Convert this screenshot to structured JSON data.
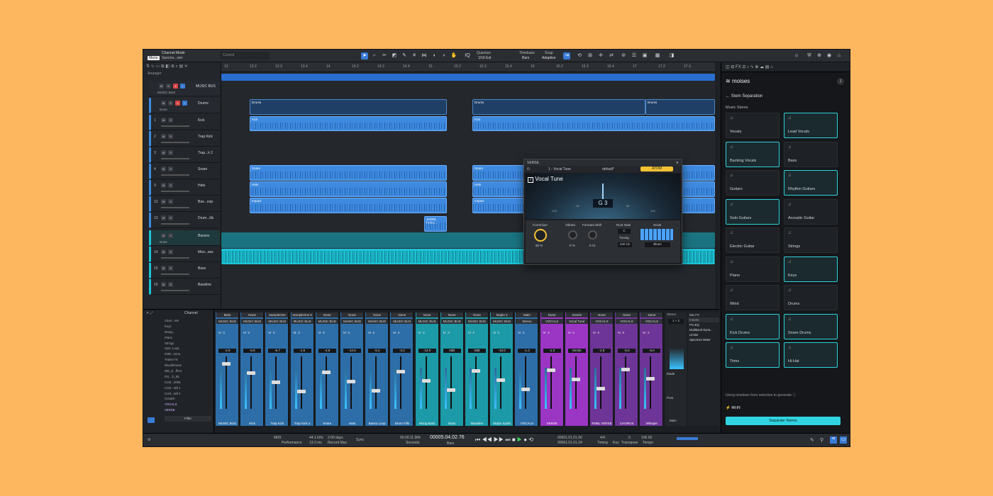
{
  "topbar": {
    "mode_label": "Channel Mode",
    "mode_value": "Spectra...ster",
    "control_label": "Control",
    "quantize_label": "Quantize",
    "quantize_value": "1/16 Ext",
    "timebase_label": "Timebase",
    "timebase_value": "Bars",
    "snap_label": "Snap",
    "snap_value": "Adaptive",
    "badge": "Mono"
  },
  "ruler": [
    "13",
    "13.2",
    "13.3",
    "13.4",
    "14",
    "14.2",
    "14.3",
    "14.4",
    "15",
    "15.2",
    "15.3",
    "15.4",
    "16",
    "16.2",
    "16.3",
    "16.4",
    "17",
    "17.2",
    "17.3"
  ],
  "tracks": {
    "arranger_label": "Arranger",
    "folders": [
      {
        "label": "MUSIC BUS",
        "sub": "MUSIC BUS"
      },
      {
        "label": "Drums",
        "sub": "None"
      },
      {
        "label": "Basses",
        "sub": "None"
      }
    ],
    "rows": [
      {
        "num": "1",
        "name": "Kick"
      },
      {
        "num": "2",
        "name": "Trap Kick"
      },
      {
        "num": "3",
        "name": "Trap...k 2"
      },
      {
        "num": "4",
        "name": "Snare"
      },
      {
        "num": "9",
        "name": "Hats"
      },
      {
        "num": "12",
        "name": "Bas...oop"
      },
      {
        "num": "13",
        "name": "Drum...ills"
      },
      {
        "num": "14",
        "name": "Moo...ass"
      },
      {
        "num": "15",
        "name": "Bass"
      },
      {
        "num": "16",
        "name": "Bassline"
      }
    ],
    "clips": {
      "drums": "Drums",
      "kick": "Kick",
      "snare": "Snare",
      "hats": "Hats",
      "impact": "Impact",
      "fill": "JHDRL FHDJ..."
    }
  },
  "plugin": {
    "window_title": "VERSE",
    "preset_slot": "1 - Vocal Tune",
    "preset_name": "default*",
    "mode_badge": "ATOM",
    "name": "Vocal Tune",
    "note": "G 3",
    "scale_marks": [
      "-100",
      "-50",
      "0",
      "50",
      "100"
    ],
    "correction_label": "Correction",
    "correction_value": "80 %",
    "vibrato_label": "Vibrato",
    "vibrato_value": "0 %",
    "formant_label": "Formant Shift",
    "formant_value": "0 Ct",
    "rootnote_label": "Root Note",
    "rootnote_value": "C",
    "tuning_label": "Tuning",
    "tuning_value": "440 Hz",
    "scale_label": "Scale",
    "scale_value": "Blues"
  },
  "moises": {
    "brand": "moises",
    "section": "Stem Separation",
    "group": "Music Stems",
    "stems": [
      {
        "label": "Vocals",
        "sel": false
      },
      {
        "label": "Lead Vocals",
        "sel": true
      },
      {
        "label": "Backing Vocals",
        "sel": true
      },
      {
        "label": "Bass",
        "sel": false
      },
      {
        "label": "Guitars",
        "sel": false
      },
      {
        "label": "Rhythm Guitars",
        "sel": true
      },
      {
        "label": "Solo Guitars",
        "sel": true
      },
      {
        "label": "Acoustic Guitar",
        "sel": false
      },
      {
        "label": "Electric Guitar",
        "sel": false
      },
      {
        "label": "Strings",
        "sel": false
      },
      {
        "label": "Piano",
        "sel": false
      },
      {
        "label": "Keys",
        "sel": true
      },
      {
        "label": "Wind",
        "sel": false
      },
      {
        "label": "Drums",
        "sel": false
      },
      {
        "label": "Kick Drums",
        "sel": true
      },
      {
        "label": "Snare Drums",
        "sel": true
      },
      {
        "label": "Toms",
        "sel": true
      },
      {
        "label": "Hi-Hat",
        "sel": true
      }
    ],
    "hint": "Using mixdown from selection to generate",
    "hifi": "HI-FI",
    "button": "Separate Stems"
  },
  "mixer": {
    "channel_header": "Channel",
    "channel_list": [
      "Clear...ism",
      "Keys",
      "Moog...",
      "Piano",
      "Strings",
      "Synt..Loop",
      "KNR...Grou",
      "Trailer FX",
      "Woodshome",
      "WD_E...ffect",
      "OS....h_55",
      "Cor0...2066",
      "Cor0...Wil 1",
      "Cor0...Wil 2",
      "Scratch",
      "VOCALS",
      "VERSE"
    ],
    "filter_label": "Filter",
    "strips": [
      {
        "top": "Main",
        "bus": "MUSIC BUS",
        "val": "-2.9",
        "foot": "MUSIC BUS",
        "color": "#2d6ea8"
      },
      {
        "top": "None",
        "bus": "MUSIC BUS",
        "val": "-5.8",
        "foot": "Kick",
        "color": "#2d6ea8"
      },
      {
        "top": "SampleOne",
        "bus": "MUSIC BUS",
        "val": "-6.7",
        "foot": "Trap Kick",
        "color": "#2d6ea8"
      },
      {
        "top": "SampleOne 5",
        "bus": "MUSIC BUS",
        "val": "-1.9",
        "foot": "Trap Kick 2",
        "color": "#2d6ea8"
      },
      {
        "top": "None",
        "bus": "MUSIC BUS",
        "val": "-4.5",
        "foot": "Snare",
        "color": "#2d6ea8"
      },
      {
        "top": "None",
        "bus": "MUSIC BUS",
        "val": "-14.0",
        "foot": "Hats",
        "color": "#2d6ea8"
      },
      {
        "top": "None",
        "bus": "MUSIC BUS",
        "val": "-5.2",
        "foot": "Basso Loop",
        "color": "#2d6ea8"
      },
      {
        "top": "None",
        "bus": "MUSIC BUS",
        "val": "-3.2",
        "foot": "Drum Fills",
        "color": "#2d6ea8"
      },
      {
        "top": "None",
        "bus": "MUSIC BUS",
        "val": "-13.0",
        "foot": "Moog Bass",
        "color": "#1c9aa8"
      },
      {
        "top": "None",
        "bus": "MUSIC BUS",
        "val": "0dB",
        "foot": "Bass",
        "color": "#1c9aa8"
      },
      {
        "top": "None",
        "bus": "MUSIC BUS",
        "val": "0dB",
        "foot": "Bassline",
        "color": "#1c9aa8"
      },
      {
        "top": "Mojito 2",
        "bus": "MUSIC BUS",
        "val": "-10.0",
        "foot": "Mojito Synth",
        "color": "#1c9aa8"
      },
      {
        "top": "Main",
        "bus": "Stereo",
        "val": "-1.4",
        "foot": "VOCALS",
        "color": "#2d6ea8"
      },
      {
        "top": "None",
        "bus": "VOCALS",
        "val": "-1.3",
        "foot": "VERSE",
        "color": "#9a35c4"
      },
      {
        "top": "Inserts",
        "bus": "Vocal Tune",
        "val": "Sends",
        "foot": "",
        "color": "#9a35c4"
      },
      {
        "top": "None",
        "bus": "VOCALS",
        "val": "-2.5",
        "foot": "RNBL VERSE",
        "color": "#6e3598"
      },
      {
        "top": "None",
        "bus": "VOCALS",
        "val": "-5.0",
        "foot": "CHORUS",
        "color": "#6e3598"
      },
      {
        "top": "None",
        "bus": "VOCALS",
        "val": "-6.0",
        "foot": "Whisper",
        "color": "#6e3598"
      }
    ],
    "main_strip": {
      "label": "Main",
      "inserts": "Inserts",
      "fx": [
        "Pro EQ",
        "Multiband Dyna...",
        "Limiter",
        "Spectrum Meter"
      ],
      "mix_fx": "Mix FX",
      "post": "Post",
      "sel": "1 + 2"
    }
  },
  "bottombar": {
    "midi": "MIDI",
    "performance": "Performance",
    "samplerate": "44.1 kHz",
    "latency": "13.3 ms",
    "days": "2:00 days",
    "recmax": "Record Max",
    "sync": "Sync",
    "seconds_value": "00:00:11.984",
    "seconds_label": "Seconds",
    "bars_value": "00005.04.02.76",
    "bars_label": "Bars",
    "loop_start": "00001.01.01.00",
    "loop_end": "00061.01.01.24",
    "timing_value": "4/4",
    "timing_label": "Timing",
    "key_label": "Key",
    "transpose_value": "0",
    "transpose_label": "Transpose",
    "tempo_value": "106.00",
    "tempo_label": "Tempo"
  }
}
